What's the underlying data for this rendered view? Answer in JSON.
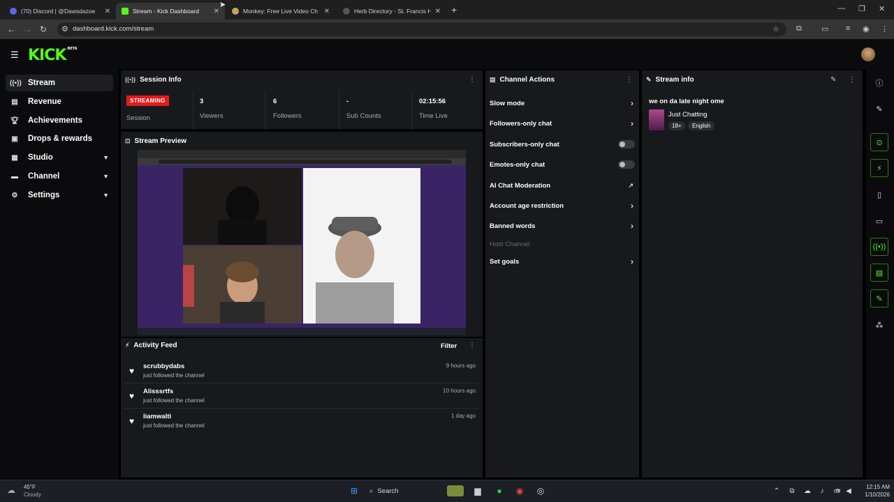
{
  "browser": {
    "tabs": [
      {
        "title": "(70) Discord | @Dawsdazoe",
        "active": false
      },
      {
        "title": "Stream - Kick Dashboard",
        "active": true
      },
      {
        "title": "Monkey: Free Live Video Ch",
        "active": false
      },
      {
        "title": "Herb Directory - St. Francis Her",
        "active": false
      }
    ],
    "url": "dashboard.kick.com/stream"
  },
  "header": {
    "logo": "KICK",
    "beta": "BETA"
  },
  "sidebar": {
    "items": [
      {
        "label": "Stream",
        "icon": "broadcast-icon",
        "selected": true
      },
      {
        "label": "Revenue",
        "icon": "revenue-icon"
      },
      {
        "label": "Achievements",
        "icon": "trophy-icon"
      },
      {
        "label": "Drops & rewards",
        "icon": "gift-icon"
      },
      {
        "label": "Studio",
        "icon": "studio-icon",
        "expandable": true
      },
      {
        "label": "Channel",
        "icon": "channel-icon",
        "expandable": true
      },
      {
        "label": "Settings",
        "icon": "gear-icon",
        "expandable": true
      }
    ]
  },
  "session": {
    "title": "Session Info",
    "status_badge": "STREAMING",
    "status_label": "Session",
    "stats": [
      {
        "value": "3",
        "label": "Viewers"
      },
      {
        "value": "6",
        "label": "Followers"
      },
      {
        "value": "-",
        "label": "Sub Counts"
      },
      {
        "value": "02:15:56",
        "label": "Time Live"
      }
    ]
  },
  "preview": {
    "title": "Stream Preview"
  },
  "activity": {
    "title": "Activity Feed",
    "filter_label": "Filter",
    "items": [
      {
        "user": "scrubbydabs",
        "action": "just followed the channel",
        "time": "9 hours ago"
      },
      {
        "user": "Alisssrtfs",
        "action": "just followed the channel",
        "time": "10 hours ago"
      },
      {
        "user": "liamwalti",
        "action": "just followed the channel",
        "time": "1 day ago"
      }
    ]
  },
  "channel_actions": {
    "title": "Channel Actions",
    "items": [
      {
        "label": "Slow mode",
        "control": "arrow"
      },
      {
        "label": "Followers-only chat",
        "control": "arrow"
      },
      {
        "label": "Subscribers-only chat",
        "control": "toggle",
        "on": false
      },
      {
        "label": "Emotes-only chat",
        "control": "toggle",
        "on": false
      },
      {
        "label": "AI Chat Moderation",
        "control": "external"
      },
      {
        "label": "Account age restriction",
        "control": "arrow"
      },
      {
        "label": "Banned words",
        "control": "arrow"
      },
      {
        "label": "Host Channel",
        "control": "none",
        "disabled": true
      },
      {
        "label": "Set goals",
        "control": "arrow"
      }
    ]
  },
  "stream_info": {
    "title": "Stream info",
    "stream_title": "we on da late night ome",
    "category": "Just Chatting",
    "tags": [
      "18+",
      "English"
    ]
  },
  "taskbar": {
    "weather_temp": "45°F",
    "weather_desc": "Cloudy",
    "search_placeholder": "Search",
    "time": "12:15 AM",
    "date": "1/10/2026"
  },
  "colors": {
    "kick_green": "#53fc18",
    "live_red": "#e21b1b",
    "panel": "#18191c"
  }
}
